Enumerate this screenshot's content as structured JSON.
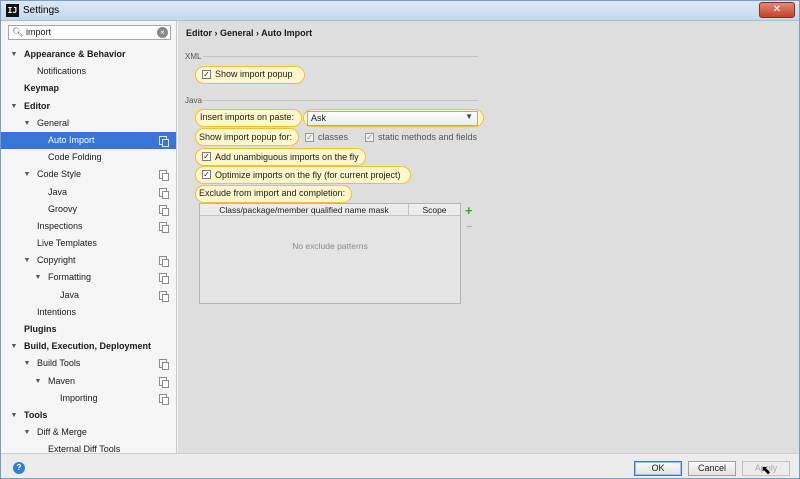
{
  "window": {
    "title": "Settings",
    "app_icon": "IJ",
    "close": "✕"
  },
  "search": {
    "value": "import",
    "icon": "search-icon"
  },
  "tree": [
    {
      "label": "Appearance & Behavior",
      "bold": true,
      "arrow": "▼",
      "level": 0
    },
    {
      "label": "Notifications",
      "bold": false,
      "arrow": "",
      "level": 1
    },
    {
      "label": "Keymap",
      "bold": true,
      "arrow": "",
      "level": 0
    },
    {
      "label": "Editor",
      "bold": true,
      "arrow": "▼",
      "level": 0
    },
    {
      "label": "General",
      "bold": false,
      "arrow": "▼",
      "level": 1
    },
    {
      "label": "Auto Import",
      "bold": false,
      "arrow": "",
      "level": 2,
      "selected": true,
      "copy": true
    },
    {
      "label": "Code Folding",
      "bold": false,
      "arrow": "",
      "level": 2
    },
    {
      "label": "Code Style",
      "bold": false,
      "arrow": "▼",
      "level": 1,
      "copy": true
    },
    {
      "label": "Java",
      "bold": false,
      "arrow": "",
      "level": 2,
      "copy": true
    },
    {
      "label": "Groovy",
      "bold": false,
      "arrow": "",
      "level": 2,
      "copy": true
    },
    {
      "label": "Inspections",
      "bold": false,
      "arrow": "",
      "level": 1,
      "copy": true
    },
    {
      "label": "Live Templates",
      "bold": false,
      "arrow": "",
      "level": 1
    },
    {
      "label": "Copyright",
      "bold": false,
      "arrow": "▼",
      "level": 1,
      "copy": true
    },
    {
      "label": "Formatting",
      "bold": false,
      "arrow": "▼",
      "level": 2,
      "copy": true
    },
    {
      "label": "Java",
      "bold": false,
      "arrow": "",
      "level": 3,
      "copy": true
    },
    {
      "label": "Intentions",
      "bold": false,
      "arrow": "",
      "level": 1
    },
    {
      "label": "Plugins",
      "bold": true,
      "arrow": "",
      "level": 0
    },
    {
      "label": "Build, Execution, Deployment",
      "bold": true,
      "arrow": "▼",
      "level": 0
    },
    {
      "label": "Build Tools",
      "bold": false,
      "arrow": "▼",
      "level": 1,
      "copy": true
    },
    {
      "label": "Maven",
      "bold": false,
      "arrow": "▼",
      "level": 2,
      "copy": true
    },
    {
      "label": "Importing",
      "bold": false,
      "arrow": "",
      "level": 3,
      "copy": true
    },
    {
      "label": "Tools",
      "bold": true,
      "arrow": "▼",
      "level": 0
    },
    {
      "label": "Diff & Merge",
      "bold": false,
      "arrow": "▼",
      "level": 1
    },
    {
      "label": "External Diff Tools",
      "bold": false,
      "arrow": "",
      "level": 2
    }
  ],
  "breadcrumb": "Editor  ›  General  ›  Auto Import",
  "xml": {
    "section": "XML",
    "show_import_popup": {
      "label": "Show import popup",
      "checked": "✓"
    }
  },
  "java": {
    "section": "Java",
    "insert_imports_label": "Insert imports on paste:",
    "insert_imports_value": "Ask",
    "show_popup_for_label": "Show import popup for:",
    "classes": {
      "label": "classes",
      "checked": "✓"
    },
    "static_methods": {
      "label": "static methods and fields",
      "checked": "✓"
    },
    "add_unambiguous": {
      "label": "Add unambiguous imports on the fly",
      "checked": "✓"
    },
    "optimize_imports": {
      "label": "Optimize imports on the fly (for current project)",
      "checked": "✓"
    },
    "exclude_label": "Exclude from import and completion:"
  },
  "exclude_table": {
    "col_mask": "Class/package/member qualified name mask",
    "col_scope": "Scope",
    "empty_text": "No exclude patterns",
    "add": "+",
    "remove": "−"
  },
  "footer": {
    "help": "?",
    "ok": "OK",
    "cancel": "Cancel",
    "apply": "Apply"
  },
  "colors": {
    "selection": "#3875d6",
    "highlight": "#f2c12e",
    "add": "#3aa02e"
  }
}
